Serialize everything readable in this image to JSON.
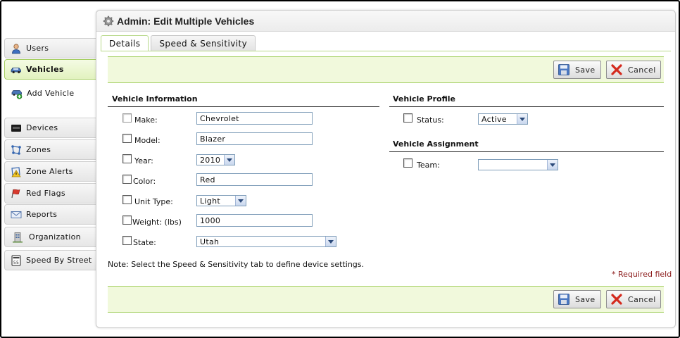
{
  "panel": {
    "title": "Admin: Edit Multiple Vehicles"
  },
  "tabs": [
    {
      "label": "Details",
      "active": true
    },
    {
      "label": "Speed & Sensitivity",
      "active": false
    }
  ],
  "sidebar": {
    "items": [
      {
        "label": "Users",
        "icon": "user-icon"
      },
      {
        "label": "Vehicles",
        "icon": "car-icon",
        "active": true
      },
      {
        "label": "Add Vehicle",
        "icon": "add-car-icon"
      },
      {
        "label": "Devices",
        "icon": "device-icon"
      },
      {
        "label": "Zones",
        "icon": "zones-icon"
      },
      {
        "label": "Zone Alerts",
        "icon": "zone-alert-icon"
      },
      {
        "label": "Red Flags",
        "icon": "red-flag-icon"
      },
      {
        "label": "Reports",
        "icon": "envelope-icon"
      },
      {
        "label": "Organization",
        "icon": "organization-icon"
      },
      {
        "label": "Speed By Street",
        "icon": "speed-sign-icon"
      }
    ]
  },
  "buttons": {
    "save": "Save",
    "cancel": "Cancel"
  },
  "vehicle_info": {
    "title": "Vehicle Information",
    "fields": {
      "make": {
        "label": "Make:",
        "value": "Chevrolet"
      },
      "model": {
        "label": "Model:",
        "value": "Blazer"
      },
      "year": {
        "label": "Year:",
        "value": "2010"
      },
      "color": {
        "label": "Color:",
        "value": "Red"
      },
      "unit_type": {
        "label": "Unit Type:",
        "value": "Light"
      },
      "weight": {
        "label": "Weight: (lbs)",
        "value": "1000"
      },
      "state": {
        "label": "State:",
        "value": "Utah"
      }
    }
  },
  "vehicle_profile": {
    "title": "Vehicle Profile",
    "status": {
      "label": "Status:",
      "value": "Active"
    }
  },
  "vehicle_assignment": {
    "title": "Vehicle Assignment",
    "team": {
      "label": "Team:",
      "value": ""
    }
  },
  "note": "Note: Select the Speed & Sensitivity tab to define device settings.",
  "required_note": "* Required field",
  "colors": {
    "accent_green": "#a8d26a",
    "bar_bg": "#f1f9dc",
    "required_red": "#8b1a1a"
  }
}
